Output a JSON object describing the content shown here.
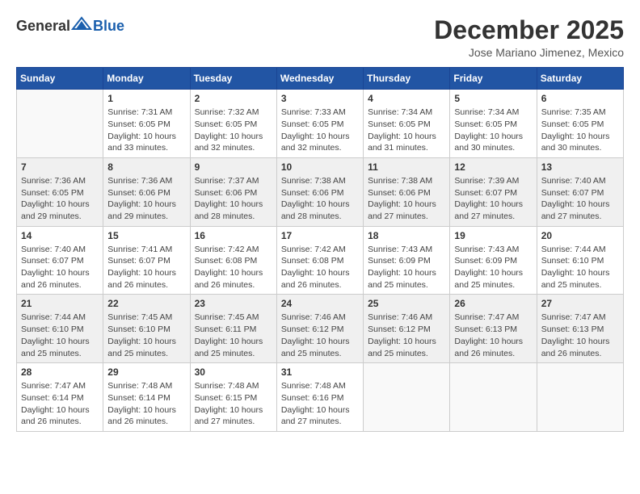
{
  "header": {
    "logo_general": "General",
    "logo_blue": "Blue",
    "month_title": "December 2025",
    "subtitle": "Jose Mariano Jimenez, Mexico"
  },
  "weekdays": [
    "Sunday",
    "Monday",
    "Tuesday",
    "Wednesday",
    "Thursday",
    "Friday",
    "Saturday"
  ],
  "weeks": [
    [
      {
        "day": "",
        "info": ""
      },
      {
        "day": "1",
        "info": "Sunrise: 7:31 AM\nSunset: 6:05 PM\nDaylight: 10 hours\nand 33 minutes."
      },
      {
        "day": "2",
        "info": "Sunrise: 7:32 AM\nSunset: 6:05 PM\nDaylight: 10 hours\nand 32 minutes."
      },
      {
        "day": "3",
        "info": "Sunrise: 7:33 AM\nSunset: 6:05 PM\nDaylight: 10 hours\nand 32 minutes."
      },
      {
        "day": "4",
        "info": "Sunrise: 7:34 AM\nSunset: 6:05 PM\nDaylight: 10 hours\nand 31 minutes."
      },
      {
        "day": "5",
        "info": "Sunrise: 7:34 AM\nSunset: 6:05 PM\nDaylight: 10 hours\nand 30 minutes."
      },
      {
        "day": "6",
        "info": "Sunrise: 7:35 AM\nSunset: 6:05 PM\nDaylight: 10 hours\nand 30 minutes."
      }
    ],
    [
      {
        "day": "7",
        "info": "Sunrise: 7:36 AM\nSunset: 6:05 PM\nDaylight: 10 hours\nand 29 minutes."
      },
      {
        "day": "8",
        "info": "Sunrise: 7:36 AM\nSunset: 6:06 PM\nDaylight: 10 hours\nand 29 minutes."
      },
      {
        "day": "9",
        "info": "Sunrise: 7:37 AM\nSunset: 6:06 PM\nDaylight: 10 hours\nand 28 minutes."
      },
      {
        "day": "10",
        "info": "Sunrise: 7:38 AM\nSunset: 6:06 PM\nDaylight: 10 hours\nand 28 minutes."
      },
      {
        "day": "11",
        "info": "Sunrise: 7:38 AM\nSunset: 6:06 PM\nDaylight: 10 hours\nand 27 minutes."
      },
      {
        "day": "12",
        "info": "Sunrise: 7:39 AM\nSunset: 6:07 PM\nDaylight: 10 hours\nand 27 minutes."
      },
      {
        "day": "13",
        "info": "Sunrise: 7:40 AM\nSunset: 6:07 PM\nDaylight: 10 hours\nand 27 minutes."
      }
    ],
    [
      {
        "day": "14",
        "info": "Sunrise: 7:40 AM\nSunset: 6:07 PM\nDaylight: 10 hours\nand 26 minutes."
      },
      {
        "day": "15",
        "info": "Sunrise: 7:41 AM\nSunset: 6:07 PM\nDaylight: 10 hours\nand 26 minutes."
      },
      {
        "day": "16",
        "info": "Sunrise: 7:42 AM\nSunset: 6:08 PM\nDaylight: 10 hours\nand 26 minutes."
      },
      {
        "day": "17",
        "info": "Sunrise: 7:42 AM\nSunset: 6:08 PM\nDaylight: 10 hours\nand 26 minutes."
      },
      {
        "day": "18",
        "info": "Sunrise: 7:43 AM\nSunset: 6:09 PM\nDaylight: 10 hours\nand 25 minutes."
      },
      {
        "day": "19",
        "info": "Sunrise: 7:43 AM\nSunset: 6:09 PM\nDaylight: 10 hours\nand 25 minutes."
      },
      {
        "day": "20",
        "info": "Sunrise: 7:44 AM\nSunset: 6:10 PM\nDaylight: 10 hours\nand 25 minutes."
      }
    ],
    [
      {
        "day": "21",
        "info": "Sunrise: 7:44 AM\nSunset: 6:10 PM\nDaylight: 10 hours\nand 25 minutes."
      },
      {
        "day": "22",
        "info": "Sunrise: 7:45 AM\nSunset: 6:10 PM\nDaylight: 10 hours\nand 25 minutes."
      },
      {
        "day": "23",
        "info": "Sunrise: 7:45 AM\nSunset: 6:11 PM\nDaylight: 10 hours\nand 25 minutes."
      },
      {
        "day": "24",
        "info": "Sunrise: 7:46 AM\nSunset: 6:12 PM\nDaylight: 10 hours\nand 25 minutes."
      },
      {
        "day": "25",
        "info": "Sunrise: 7:46 AM\nSunset: 6:12 PM\nDaylight: 10 hours\nand 25 minutes."
      },
      {
        "day": "26",
        "info": "Sunrise: 7:47 AM\nSunset: 6:13 PM\nDaylight: 10 hours\nand 26 minutes."
      },
      {
        "day": "27",
        "info": "Sunrise: 7:47 AM\nSunset: 6:13 PM\nDaylight: 10 hours\nand 26 minutes."
      }
    ],
    [
      {
        "day": "28",
        "info": "Sunrise: 7:47 AM\nSunset: 6:14 PM\nDaylight: 10 hours\nand 26 minutes."
      },
      {
        "day": "29",
        "info": "Sunrise: 7:48 AM\nSunset: 6:14 PM\nDaylight: 10 hours\nand 26 minutes."
      },
      {
        "day": "30",
        "info": "Sunrise: 7:48 AM\nSunset: 6:15 PM\nDaylight: 10 hours\nand 27 minutes."
      },
      {
        "day": "31",
        "info": "Sunrise: 7:48 AM\nSunset: 6:16 PM\nDaylight: 10 hours\nand 27 minutes."
      },
      {
        "day": "",
        "info": ""
      },
      {
        "day": "",
        "info": ""
      },
      {
        "day": "",
        "info": ""
      }
    ]
  ]
}
